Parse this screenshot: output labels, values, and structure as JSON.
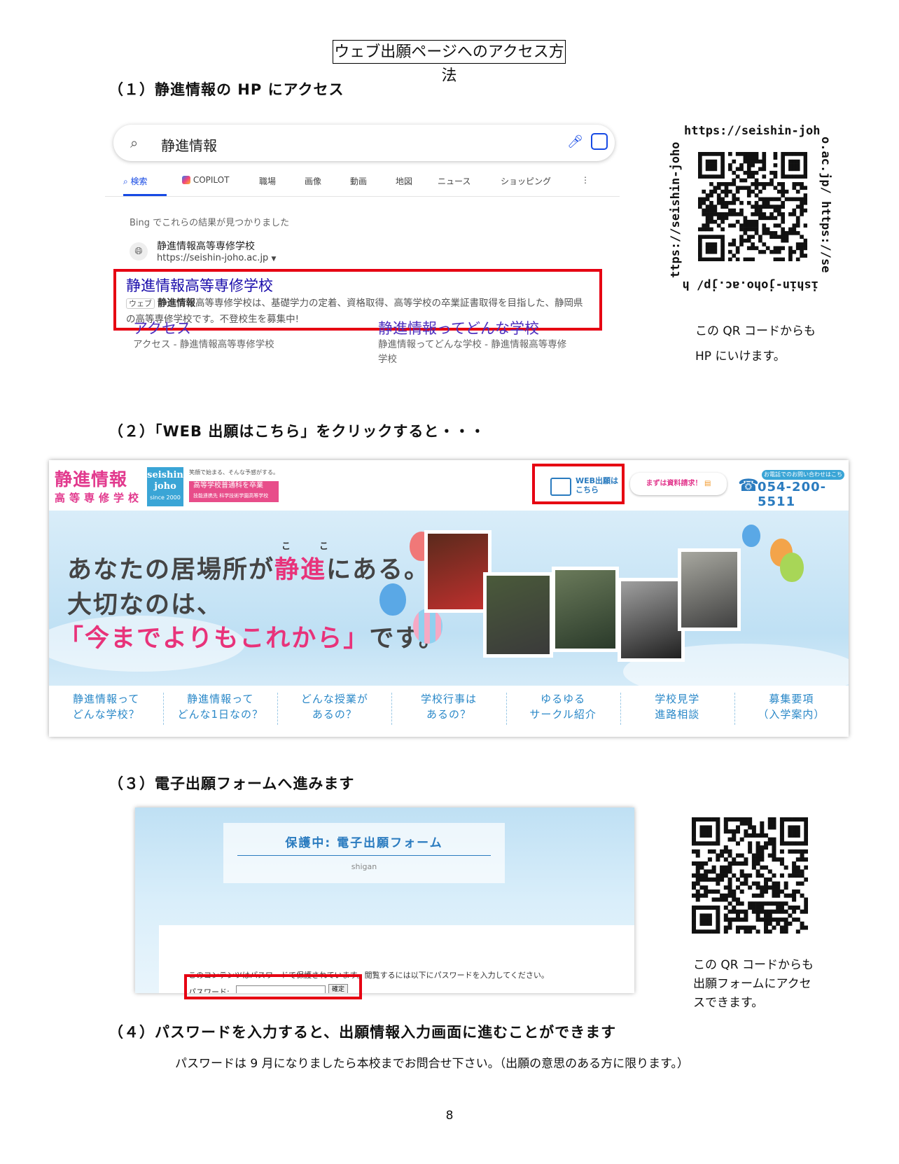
{
  "title": "ウェブ出願ページへのアクセス方法",
  "steps": {
    "s1": "（１）静進情報の HP にアクセス",
    "s2": "（２）「WEB 出願はこちら」をクリックすると・・・",
    "s3": "（３）電子出願フォームへ進みます",
    "s4": "（４）パスワードを入力すると、出願情報入力画面に進むことができます"
  },
  "bing": {
    "query": "静進情報",
    "tabs": [
      "検索",
      "COPILOT",
      "職場",
      "画像",
      "動画",
      "地図",
      "ニュース",
      "ショッピング"
    ],
    "found_text": "Bing でこれらの結果が見つかりました",
    "site_name": "静進情報高等専修学校",
    "site_url": "https://seishin-joho.ac.jp",
    "result_title": "静進情報高等専修学校",
    "result_tag": "ウェブ",
    "result_bold": "静進情報",
    "result_desc": "高等専修学校は、基礎学力の定着、資格取得、高等学校の卒業証書取得を目指した、静岡県の高等専修学校です。不登校生を募集中!",
    "sub1_title": "アクセス",
    "sub1_desc": "アクセス - 静進情報高等専修学校",
    "sub2_title": "静進情報ってどんな学校",
    "sub2_desc": "静進情報ってどんな学校 - 静進情報高等専修学校"
  },
  "qr1": {
    "top": "https://seishin-joh",
    "right": "o.ac.jp/ https://se",
    "bottom": "ishin-joho.ac.jp/ h",
    "left": "ttps://seishin-joho",
    "caption1": "この QR コードからも",
    "caption2": "HP にいけます。"
  },
  "site": {
    "logo_main": "静進情報",
    "logo_sub": "高等専修学校",
    "logo_seishin1": "seishin",
    "logo_seishin2": "joho",
    "logo_since": "since 2000",
    "tagline": "笑顔で始まる、そんな予感がする。",
    "pink_line1": "高等学校普通科を卒業",
    "pink_line2": "技能連携先 科学技術学園高等学校",
    "web_btn_line1": "WEB出願は",
    "web_btn_line2": "こちら",
    "shiryo": "まずは資料請求！",
    "tel_label": "お電話でのお問い合わせはこちら",
    "tel": "054-200-5511",
    "hero_ruby": "こ　こ",
    "hero_l1a": "あなたの居場所が",
    "hero_l1b": "静進",
    "hero_l1c": "にある。",
    "hero_l2": "大切なのは、",
    "hero_l3a": "「今までよりもこれから」",
    "hero_l3b": "です。",
    "nav": [
      [
        "静進情報って",
        "どんな学校？"
      ],
      [
        "静進情報って",
        "どんな1日なの？"
      ],
      [
        "どんな授業が",
        "あるの？"
      ],
      [
        "学校行事は",
        "あるの？"
      ],
      [
        "ゆるゆる",
        "サークル紹介"
      ],
      [
        "学校見学",
        "進路相談"
      ],
      [
        "募集要項",
        "（入学案内）"
      ]
    ]
  },
  "form": {
    "title": "保護中: 電子出願フォーム",
    "sub": "shigan",
    "message": "このコンテンツはパスワードで保護されています。閲覧するには以下にパスワードを入力してください。",
    "pass_label": "パスワード:",
    "btn": "確定"
  },
  "qr2": {
    "caption1": "この QR コードからも",
    "caption2": "出願フォームにアクセ",
    "caption3": "スできます。"
  },
  "note": "パスワードは 9 月になりましたら本校までお問合せ下さい。（出願の意思のある方に限ります。）",
  "page_number": "8",
  "colors": {
    "highlight_red": "#e60012",
    "brand_pink": "#e23a8e",
    "brand_blue": "#2a7bbf",
    "bing_blue": "#174ae4"
  }
}
